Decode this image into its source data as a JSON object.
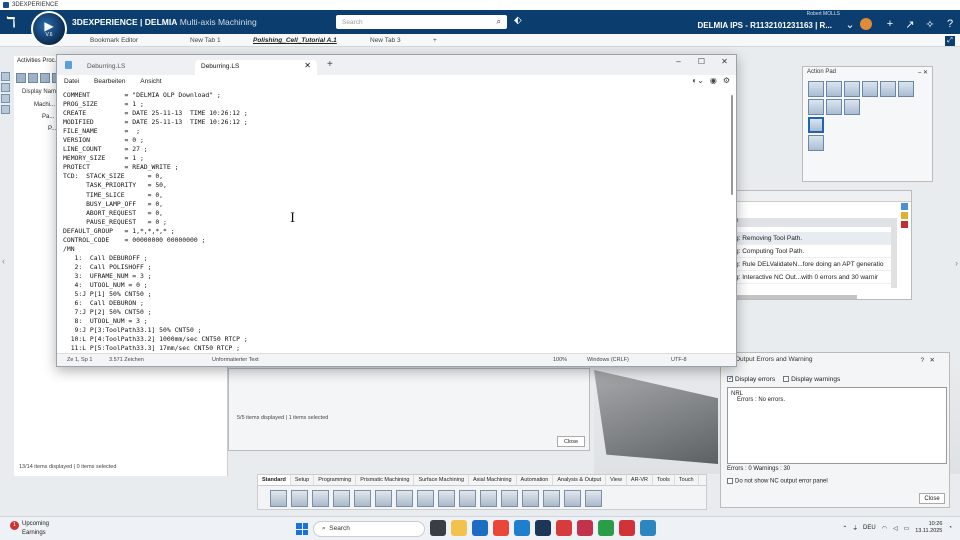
{
  "window_title": "3DEXPERIENCE",
  "compass": {
    "version": "V.6"
  },
  "app": {
    "brand_bold": "3DEXPERIENCE | DELMIA",
    "brand_app": "Multi-axis Machining",
    "search_placeholder": "Search",
    "user_name": "Robert MOLLS",
    "context": "DELMIA IPS - R1132101231163 | R..."
  },
  "editor_tabs": [
    "Bookmark Editor",
    "New Tab 1",
    "Polishing_Cell_Tutorial A.1",
    "New Tab 3"
  ],
  "left_panel": {
    "title": "Activities Proc...",
    "display": "Display Name",
    "tree": [
      "Machi...",
      "Pa...",
      "P..."
    ],
    "status": "13/14 items displayed | 0 items selected"
  },
  "bg_dialog": {
    "status": "5/5 items displayed | 1 items selected",
    "close": "Close"
  },
  "action_pad": {
    "title": "Action Pad"
  },
  "log_panel": {
    "rows": [
      "g: Removing Tool Path.",
      "g: Computing Tool Path.",
      "g: Rule DELValidateN...fore doing an APT generatio",
      "g: Interactive NC Out...with 0 errors and 30 warnir"
    ]
  },
  "output_panel": {
    "title": "Output Errors and Warning",
    "display_errors": "Display errors",
    "display_warnings": "Display warnings",
    "box_head": "NRL",
    "box_error": "Errors :  No errors.",
    "counts": "Errors : 0    Warnings : 30",
    "no_show": "Do not show NC output error panel",
    "close": "Close"
  },
  "toolbar_tabs": [
    "Standard",
    "Setup",
    "Programming",
    "Prismatic Machining",
    "Surface Machining",
    "Axial Machining",
    "Automation",
    "Analysis & Output",
    "View",
    "AR-VR",
    "Tools",
    "Touch"
  ],
  "notepad": {
    "tab_inactive": "Deburring.LS",
    "tab_active": "Deburring.LS",
    "menus": [
      "Datei",
      "Bearbeiten",
      "Ansicht"
    ],
    "content": "COMMENT         = \"DELMIA OLP Download\" ;\nPROG_SIZE       = 1 ;\nCREATE          = DATE 25-11-13  TIME 10:26:12 ;\nMODIFIED        = DATE 25-11-13  TIME 10:26:12 ;\nFILE_NAME       =  ;\nVERSION         = 0 ;\nLINE_COUNT      = 27 ;\nMEMORY_SIZE     = 1 ;\nPROTECT         = READ_WRITE ;\nTCD:  STACK_SIZE      = 0,\n      TASK_PRIORITY   = 50,\n      TIME_SLICE      = 0,\n      BUSY_LAMP_OFF   = 0,\n      ABORT_REQUEST   = 0,\n      PAUSE_REQUEST   = 0 ;\nDEFAULT_GROUP   = 1,*,*,*,* ;\nCONTROL_CODE    = 00000000 00000000 ;\n/MN\n   1:  Call DEBUROFF ;\n   2:  Call POLISHOFF ;\n   3:  UFRAME_NUM = 3 ;\n   4:  UTOOL_NUM = 0 ;\n   5:J P[1] 50% CNT50 ;\n   6:  Call DEBURON ;\n   7:J P[2] 50% CNT50 ;\n   8:  UTOOL_NUM = 3 ;\n   9:J P[3:ToolPath33.1] 50% CNT50 ;\n  10:L P[4:ToolPath33.2] 1000mm/sec CNT50 RTCP ;\n  11:L P[5:ToolPath33.3] 17mm/sec CNT50 RTCP ;",
    "status_pos": "Ze 1, Sp 1",
    "status_chars": "3.571 Zeichen",
    "status_format": "Unformatierter Text",
    "status_zoom": "100%",
    "status_eol": "Windows (CRLF)",
    "status_enc": "UTF-8"
  },
  "taskbar": {
    "weather_title": "Upcoming",
    "weather_sub": "Earnings",
    "weather_badge": "1",
    "search": "Search",
    "lang": "DEU",
    "time": "10:26",
    "date": "13.11.2025"
  }
}
